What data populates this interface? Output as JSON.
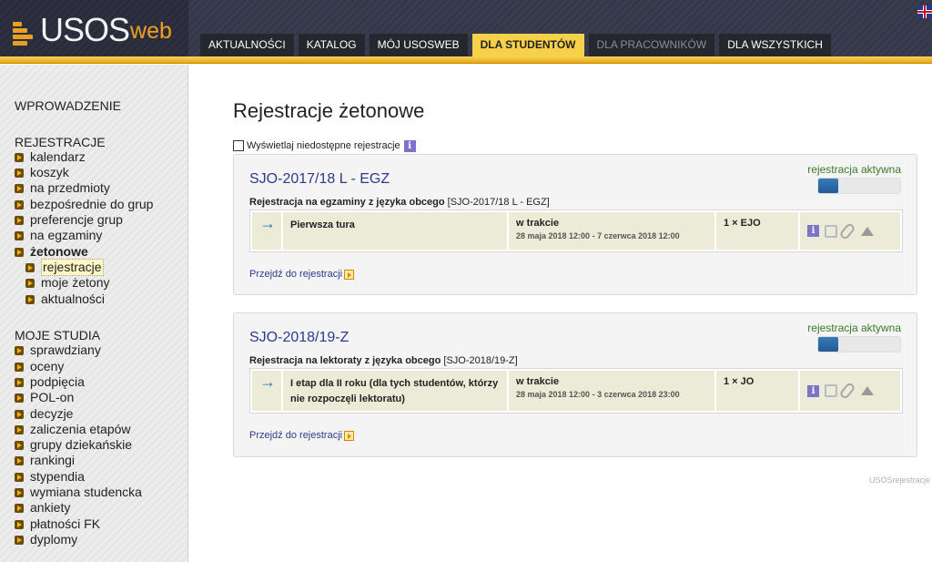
{
  "header": {
    "logo_main": "USOS",
    "logo_web": "web",
    "tabs": [
      {
        "label": "AKTUALNOŚCI"
      },
      {
        "label": "KATALOG"
      },
      {
        "label": "MÓJ USOSWEB"
      },
      {
        "label": "DLA STUDENTÓW"
      },
      {
        "label": "DLA PRACOWNIKÓW"
      },
      {
        "label": "DLA WSZYSTKICH"
      }
    ],
    "active_tab": "DLA STUDENTÓW",
    "language_flag": "uk-flag-icon"
  },
  "sidebar": {
    "intro": "WPROWADZENIE",
    "sections": [
      {
        "title": "REJESTRACJE",
        "items": [
          {
            "label": "kalendarz"
          },
          {
            "label": "koszyk"
          },
          {
            "label": "na przedmioty"
          },
          {
            "label": "bezpośrednie do grup"
          },
          {
            "label": "preferencje grup"
          },
          {
            "label": "na egzaminy"
          },
          {
            "label": "żetonowe"
          }
        ],
        "subitems": [
          {
            "label": "rejestracje"
          },
          {
            "label": "moje żetony"
          },
          {
            "label": "aktualności"
          }
        ]
      },
      {
        "title": "MOJE STUDIA",
        "items": [
          {
            "label": "sprawdziany"
          },
          {
            "label": "oceny"
          },
          {
            "label": "podpięcia"
          },
          {
            "label": "POL-on"
          },
          {
            "label": "decyzje"
          },
          {
            "label": "zaliczenia etapów"
          },
          {
            "label": "grupy dziekańskie"
          },
          {
            "label": "rankingi"
          },
          {
            "label": "stypendia"
          },
          {
            "label": "wymiana studencka"
          },
          {
            "label": "ankiety"
          },
          {
            "label": "płatności FK"
          },
          {
            "label": "dyplomy"
          }
        ]
      }
    ]
  },
  "main": {
    "title": "Rejestracje żetonowe",
    "show_unavailable_label": "Wyświetlaj niedostępne rejestracje",
    "registrations": [
      {
        "title": "SJO-2017/18 L - EGZ",
        "status": "rejestracja aktywna",
        "desc_bold": "Rejestracja na egzaminy z języka obcego",
        "desc_code": "[SJO-2017/18 L - EGZ]",
        "round": {
          "arrow": "→",
          "name": "Pierwsza tura",
          "state": "w trakcie",
          "dates": "28 maja 2018 12:00 - 7 czerwca 2018 12:00",
          "tokens": "1 × EJO"
        },
        "link": "Przejdź do rejestracji"
      },
      {
        "title": "SJO-2018/19-Z",
        "status": "rejestracja aktywna",
        "desc_bold": "Rejestracja na lektoraty z języka obcego",
        "desc_code": "[SJO-2018/19-Z]",
        "round": {
          "arrow": "→",
          "name": "I etap dla II roku (dla tych studentów, którzy nie rozpoczęli lektoratu)",
          "state": "w trakcie",
          "dates": "28 maja 2018 12:00 - 3 czerwca 2018 23:00",
          "tokens": "1 × JO"
        },
        "link": "Przejdź do rejestracji"
      }
    ],
    "footer_tag": "USOSrejestracje"
  },
  "colors": {
    "accent_gold": "#f7d04a",
    "panel_title": "#2e3a8c",
    "status_green": "#3b7a2a"
  }
}
